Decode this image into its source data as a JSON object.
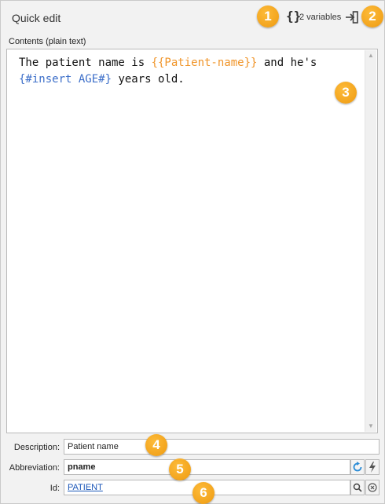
{
  "header": {
    "title": "Quick edit",
    "variables_icon": "curly-braces-icon",
    "variables_label": "2 variables",
    "insert_icon": "insert-arrow-icon"
  },
  "editor": {
    "label": "Contents (plain text)",
    "segments": [
      {
        "text": "The patient name is ",
        "style": "plain"
      },
      {
        "text": "{{Patient-name}}",
        "style": "orange"
      },
      {
        "text": " and he's\n",
        "style": "plain"
      },
      {
        "text": "{#insert AGE#}",
        "style": "blue"
      },
      {
        "text": " years old.",
        "style": "plain"
      }
    ]
  },
  "form": {
    "description_label": "Description:",
    "description_value": "Patient name",
    "abbreviation_label": "Abbreviation:",
    "abbreviation_value": "pname",
    "id_label": "Id:",
    "id_value": "PATIENT"
  },
  "badges": [
    "1",
    "2",
    "3",
    "4",
    "5",
    "6"
  ],
  "colors": {
    "badge": "#F5A623",
    "variable_orange": "#F0952A",
    "variable_blue": "#3D6FC9",
    "refresh_icon": "#2B8CD6"
  }
}
